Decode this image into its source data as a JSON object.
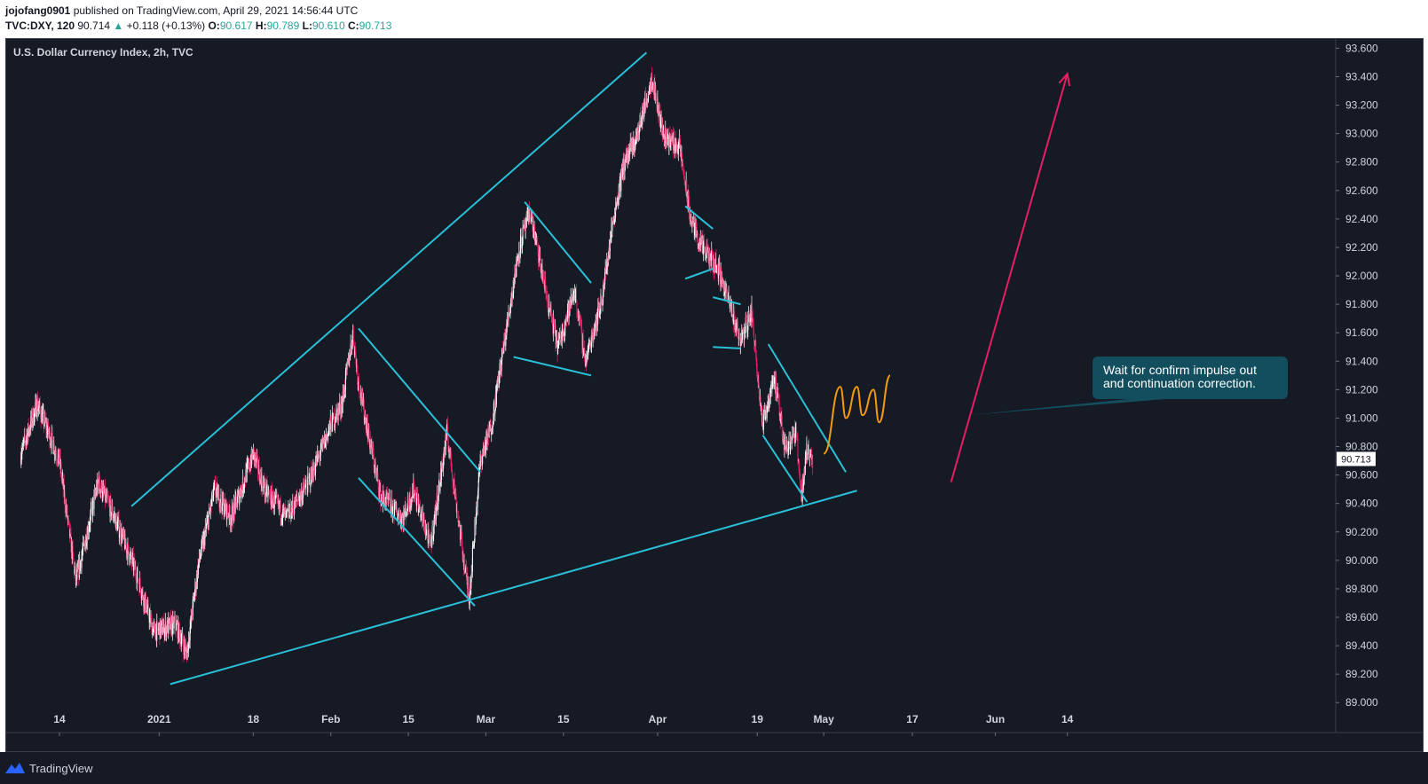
{
  "header": {
    "publisher": "jojofang0901",
    "published_text": " published on TradingView.com, April 29, 2021 14:56:44 UTC",
    "symbol": "TVC:DXY, 120",
    "price": "90.714",
    "change": "+0.118 (+0.13%)",
    "o_label": "O:",
    "o_value": "90.617",
    "h_label": "H:",
    "h_value": "90.789",
    "l_label": "L:",
    "l_value": "90.610",
    "c_label": "C:",
    "c_value": "90.713"
  },
  "footer": {
    "brand": "TradingView"
  },
  "colors": {
    "background": "#161a25",
    "trendline": "#29c0d8",
    "projection": "#f59a0e",
    "arrow": "#e91e63",
    "candle_up": "#ffffff",
    "candle_down": "#e91e63",
    "note_bg": "#134e5e"
  },
  "chart_data": {
    "type": "candlestick",
    "title": "U.S. Dollar Currency Index, 2h, TVC",
    "xlabel": "",
    "ylabel": "",
    "ylim": [
      88.985,
      93.64
    ],
    "y_ticks": [
      "93.600",
      "93.400",
      "93.200",
      "93.000",
      "92.800",
      "92.600",
      "92.400",
      "92.200",
      "92.000",
      "91.800",
      "91.600",
      "91.400",
      "91.200",
      "91.000",
      "90.800",
      "90.600",
      "90.400",
      "90.200",
      "90.000",
      "89.800",
      "89.600",
      "89.400",
      "89.200",
      "89.000"
    ],
    "x_ticks": [
      "14",
      "2021",
      "18",
      "Feb",
      "15",
      "Mar",
      "15",
      "Apr",
      "19",
      "May",
      "17",
      "Jun",
      "14"
    ],
    "x_tick_dates": [
      "2020-12-14",
      "2021-01-01",
      "2021-01-18",
      "2021-02-01",
      "2021-02-15",
      "2021-03-01",
      "2021-03-15",
      "2021-04-01",
      "2021-04-19",
      "2021-05-01",
      "2021-05-17",
      "2021-06-01",
      "2021-06-14"
    ],
    "last_price_label": "90.713",
    "price_path": [
      [
        "2020-12-07",
        90.75
      ],
      [
        "2020-12-10",
        91.1
      ],
      [
        "2020-12-14",
        90.7
      ],
      [
        "2020-12-17",
        89.85
      ],
      [
        "2020-12-21",
        90.55
      ],
      [
        "2020-12-24",
        90.3
      ],
      [
        "2020-12-28",
        89.9
      ],
      [
        "2020-12-31",
        89.5
      ],
      [
        "2021-01-04",
        89.55
      ],
      [
        "2021-01-06",
        89.35
      ],
      [
        "2021-01-08",
        89.95
      ],
      [
        "2021-01-11",
        90.5
      ],
      [
        "2021-01-14",
        90.3
      ],
      [
        "2021-01-18",
        90.75
      ],
      [
        "2021-01-20",
        90.5
      ],
      [
        "2021-01-24",
        90.3
      ],
      [
        "2021-01-28",
        90.55
      ],
      [
        "2021-02-01",
        90.95
      ],
      [
        "2021-02-03",
        91.1
      ],
      [
        "2021-02-05",
        91.6
      ],
      [
        "2021-02-06",
        91.25
      ],
      [
        "2021-02-10",
        90.45
      ],
      [
        "2021-02-14",
        90.3
      ],
      [
        "2021-02-16",
        90.5
      ],
      [
        "2021-02-19",
        90.1
      ],
      [
        "2021-02-22",
        90.9
      ],
      [
        "2021-02-25",
        90.0
      ],
      [
        "2021-02-26",
        89.75
      ],
      [
        "2021-02-28",
        90.7
      ],
      [
        "2021-03-02",
        90.95
      ],
      [
        "2021-03-05",
        91.7
      ],
      [
        "2021-03-07",
        92.2
      ],
      [
        "2021-03-09",
        92.45
      ],
      [
        "2021-03-12",
        91.85
      ],
      [
        "2021-03-14",
        91.5
      ],
      [
        "2021-03-17",
        91.9
      ],
      [
        "2021-03-19",
        91.4
      ],
      [
        "2021-03-22",
        91.85
      ],
      [
        "2021-03-24",
        92.4
      ],
      [
        "2021-03-26",
        92.8
      ],
      [
        "2021-03-28",
        92.95
      ],
      [
        "2021-03-31",
        93.4
      ],
      [
        "2021-04-02",
        93.0
      ],
      [
        "2021-04-05",
        92.9
      ],
      [
        "2021-04-07",
        92.4
      ],
      [
        "2021-04-09",
        92.2
      ],
      [
        "2021-04-12",
        92.05
      ],
      [
        "2021-04-14",
        91.8
      ],
      [
        "2021-04-16",
        91.55
      ],
      [
        "2021-04-18",
        91.75
      ],
      [
        "2021-04-20",
        90.95
      ],
      [
        "2021-04-22",
        91.3
      ],
      [
        "2021-04-24",
        90.8
      ],
      [
        "2021-04-26",
        90.9
      ],
      [
        "2021-04-27",
        90.45
      ],
      [
        "2021-04-28",
        90.8
      ],
      [
        "2021-04-29",
        90.71
      ]
    ],
    "trendlines": [
      {
        "from": [
          "2020-12-27",
          90.38
        ],
        "to": [
          "2021-03-30",
          93.57
        ]
      },
      {
        "from": [
          "2021-01-03",
          89.13
        ],
        "to": [
          "2021-05-07",
          90.49
        ]
      },
      {
        "from": [
          "2021-02-06",
          91.63
        ],
        "to": [
          "2021-02-28",
          90.62
        ]
      },
      {
        "from": [
          "2021-02-06",
          90.58
        ],
        "to": [
          "2021-02-27",
          89.68
        ]
      },
      {
        "from": [
          "2021-03-08",
          92.52
        ],
        "to": [
          "2021-03-20",
          91.95
        ]
      },
      {
        "from": [
          "2021-03-06",
          91.43
        ],
        "to": [
          "2021-03-20",
          91.3
        ]
      },
      {
        "from": [
          "2021-04-06",
          92.49
        ],
        "to": [
          "2021-04-11",
          92.33
        ]
      },
      {
        "from": [
          "2021-04-06",
          91.98
        ],
        "to": [
          "2021-04-11",
          92.05
        ]
      },
      {
        "from": [
          "2021-04-11",
          91.85
        ],
        "to": [
          "2021-04-16",
          91.8
        ]
      },
      {
        "from": [
          "2021-04-11",
          91.5
        ],
        "to": [
          "2021-04-16",
          91.49
        ]
      },
      {
        "from": [
          "2021-04-21",
          91.52
        ],
        "to": [
          "2021-05-05",
          90.62
        ]
      },
      {
        "from": [
          "2021-04-20",
          90.88
        ],
        "to": [
          "2021-04-28",
          90.41
        ]
      }
    ],
    "projection": [
      [
        "2021-05-01",
        90.75
      ],
      [
        "2021-05-04",
        91.22
      ],
      [
        "2021-05-05",
        91.0
      ],
      [
        "2021-05-07",
        91.22
      ],
      [
        "2021-05-08",
        91.02
      ],
      [
        "2021-05-10",
        91.2
      ],
      [
        "2021-05-11",
        90.97
      ],
      [
        "2021-05-13",
        91.3
      ]
    ],
    "arrow": {
      "from": [
        "2021-05-24",
        90.55
      ],
      "to": [
        "2021-06-14",
        93.42
      ]
    },
    "annotation": {
      "lines": [
        "Wait for confirm impulse out",
        "and continuation correction."
      ],
      "anchor": [
        "2021-05-27",
        91.02
      ]
    }
  }
}
